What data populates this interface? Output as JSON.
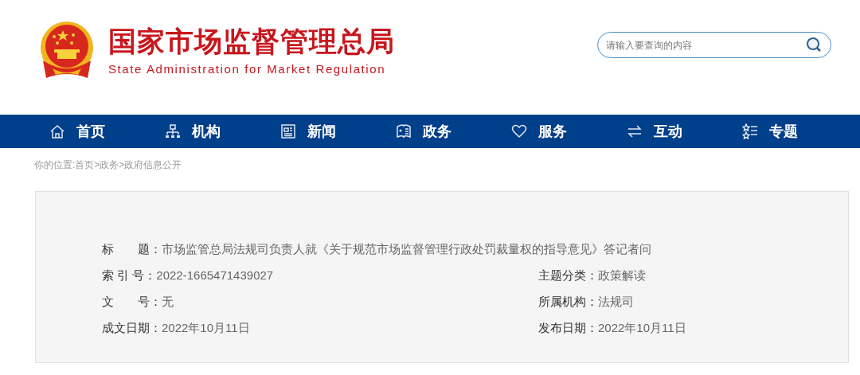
{
  "header": {
    "title": "国家市场监督管理总局",
    "subtitle": "State Administration for Market Regulation",
    "search": {
      "placeholder": "请输入要查询的内容"
    }
  },
  "nav": [
    {
      "label": "首页",
      "kind": "home"
    },
    {
      "label": "机构",
      "kind": "org"
    },
    {
      "label": "新闻",
      "kind": "news"
    },
    {
      "label": "政务",
      "kind": "book"
    },
    {
      "label": "服务",
      "kind": "heart"
    },
    {
      "label": "互动",
      "kind": "swap"
    },
    {
      "label": "专题",
      "kind": "stars"
    }
  ],
  "breadcrumb": "你的位置:首页>政务>政府信息公开",
  "info": {
    "title_row": {
      "label": "标　　题：",
      "value": "市场监管总局法规司负责人就《关于规范市场监督管理行政处罚裁量权的指导意见》答记者问"
    },
    "rows": [
      [
        {
          "label": "索 引 号：",
          "value": "2022-1665471439027"
        },
        {
          "label": "主题分类：",
          "value": "政策解读"
        }
      ],
      [
        {
          "label": "文　　号：",
          "value": "无"
        },
        {
          "label": "所属机构：",
          "value": "法规司"
        }
      ],
      [
        {
          "label": "成文日期：",
          "value": "2022年10月11日"
        },
        {
          "label": "发布日期：",
          "value": "2022年10月11日"
        }
      ]
    ]
  }
}
